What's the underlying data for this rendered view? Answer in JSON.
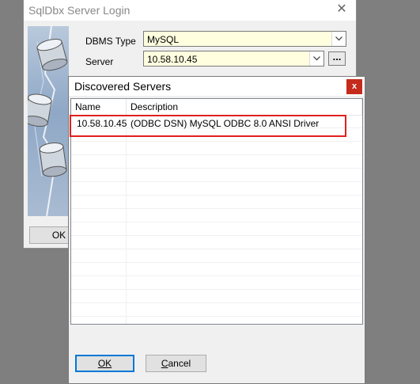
{
  "login_window": {
    "title": "SqlDbx Server Login",
    "close_glyph": "✕",
    "dbms_type_label": "DBMS Type",
    "dbms_type_value": "MySQL",
    "server_label": "Server",
    "server_value": "10.58.10.45",
    "browse_label": "...",
    "ok_label": "OK"
  },
  "discover_dialog": {
    "title": "Discovered Servers",
    "close_glyph": "x",
    "columns": {
      "name": "Name",
      "description": "Description"
    },
    "rows": [
      {
        "name": "10.58.10.45",
        "description": "(ODBC DSN) MySQL ODBC 8.0 ANSI Driver",
        "highlighted": true
      }
    ],
    "ok_label": "OK",
    "cancel_label": "Cancel"
  },
  "colors": {
    "desktop": "#7f7f7f",
    "window_bg": "#f0f0f0",
    "field_bg": "#ffffe0",
    "close_red": "#c42b1c",
    "highlight_red": "#e02020",
    "default_button_border": "#0078d7"
  },
  "icons": [
    "close-icon",
    "chevron-down-icon",
    "database-art"
  ]
}
